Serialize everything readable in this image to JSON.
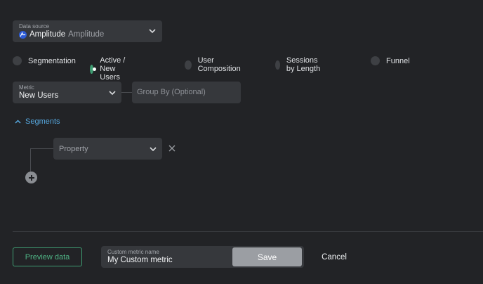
{
  "data_source": {
    "label": "Data source",
    "value": "Amplitude",
    "sub_value": "Amplitude",
    "icon": "amplitude-logo-icon"
  },
  "chart_types": [
    {
      "label": "Segmentation",
      "selected": false
    },
    {
      "label": "Active / New Users",
      "selected": true
    },
    {
      "label": "User Composition",
      "selected": false
    },
    {
      "label": "Sessions by Length",
      "selected": false
    },
    {
      "label": "Funnel",
      "selected": false
    }
  ],
  "metric": {
    "label": "Metric",
    "value": "New Users"
  },
  "group_by": {
    "placeholder": "Group By (Optional)"
  },
  "segments": {
    "label": "Segments",
    "property_placeholder": "Property"
  },
  "footer": {
    "preview_label": "Preview data",
    "custom_name_label": "Custom metric name",
    "custom_name_value": "My Custom metric",
    "save_label": "Save",
    "cancel_label": "Cancel"
  },
  "colors": {
    "background": "#222326",
    "accent_green": "#3f9d72",
    "link_blue": "#56a7de"
  }
}
